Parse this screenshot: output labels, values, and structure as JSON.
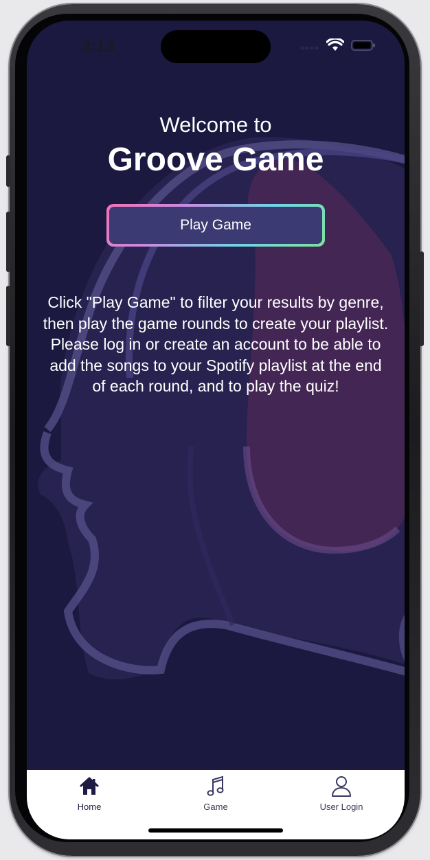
{
  "status_bar": {
    "time": "3:13"
  },
  "header": {
    "welcome": "Welcome to",
    "app_name": "Groove Game"
  },
  "play_button": {
    "label": "Play Game"
  },
  "description": "Click \"Play Game\" to filter your results by genre, then play the game rounds to create your playlist. Please log in or create an account to be able to add the songs to your Spotify playlist at the end of each round, and to play the quiz!",
  "tabs": [
    {
      "label": "Home",
      "icon": "home-icon",
      "active": true
    },
    {
      "label": "Game",
      "icon": "music-note-icon",
      "active": false
    },
    {
      "label": "User Login",
      "icon": "user-icon",
      "active": false
    }
  ],
  "colors": {
    "background": "#1c1940",
    "button_fill": "#3b3a72",
    "headphone_accent": "#4a2755",
    "tab_active": "#1e1b45"
  }
}
